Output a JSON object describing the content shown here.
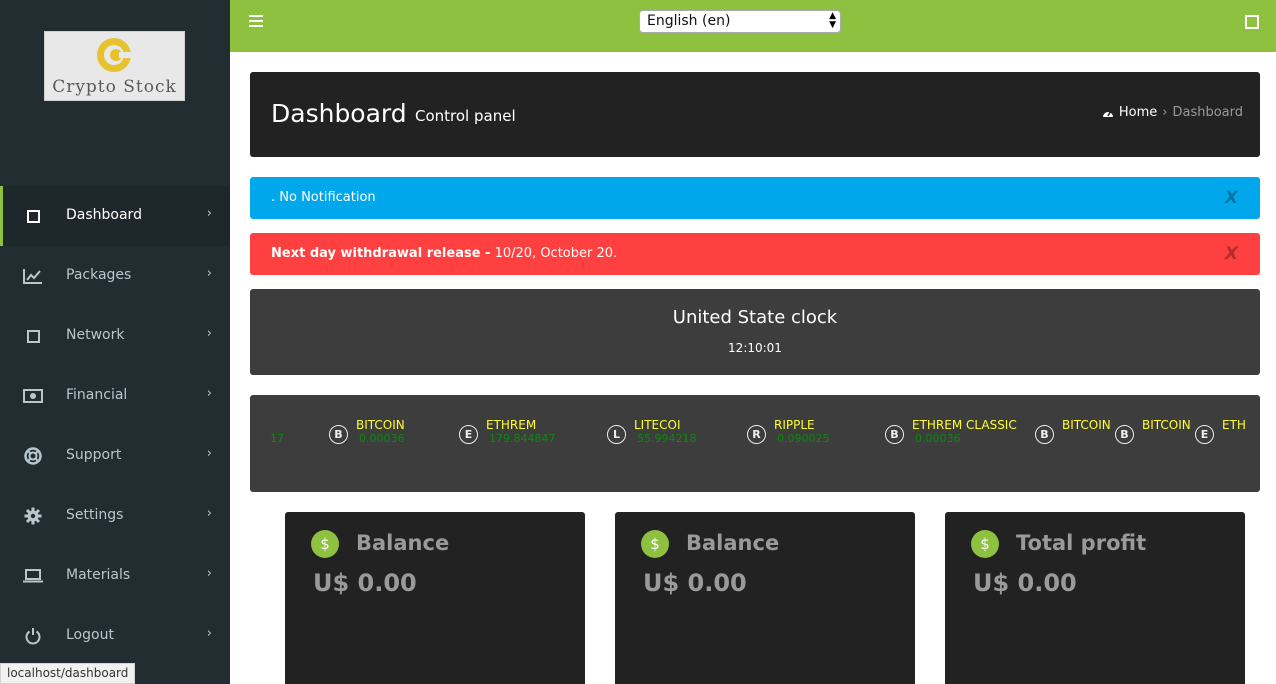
{
  "sidebar": {
    "logo_text": "Crypto Stock",
    "items": [
      {
        "label": "Dashboard",
        "icon": "square-icon",
        "active": true
      },
      {
        "label": "Packages",
        "icon": "chart-line-icon"
      },
      {
        "label": "Network",
        "icon": "square-icon"
      },
      {
        "label": "Financial",
        "icon": "money-icon"
      },
      {
        "label": "Support",
        "icon": "lifering-icon"
      },
      {
        "label": "Settings",
        "icon": "gear-icon"
      },
      {
        "label": "Materials",
        "icon": "laptop-icon"
      },
      {
        "label": "Logout",
        "icon": "power-icon"
      }
    ]
  },
  "status_bar": {
    "url": "localhost/dashboard"
  },
  "topbar": {
    "language": "English (en)"
  },
  "header": {
    "title": "Dashboard",
    "subtitle": "Control panel",
    "breadcrumb_home": "Home",
    "breadcrumb_current": "Dashboard"
  },
  "alerts": {
    "info": ". No Notification",
    "danger_bold": "Next day withdrawal release -",
    "danger_rest": " 10/20, October 20.",
    "close": "X"
  },
  "clock": {
    "title": "United State clock",
    "time": "12:10:01"
  },
  "ticker": {
    "lead": "17",
    "coins": [
      {
        "name": "BITCOIN",
        "price": "0.00036",
        "symbol": "B"
      },
      {
        "name": "ETHREM",
        "price": "179.844847",
        "symbol": "E"
      },
      {
        "name": "LITECOI",
        "price": "55.994218",
        "symbol": "L"
      },
      {
        "name": "RIPPLE",
        "price": "0.090025",
        "symbol": "R"
      },
      {
        "name": "ETHREM CLASSIC",
        "price": "0.00036",
        "symbol": "B"
      },
      {
        "name": "BITCOIN",
        "price": "",
        "symbol": "B"
      },
      {
        "name": "BITCOIN",
        "price": "",
        "symbol": "B"
      },
      {
        "name": "ETH",
        "price": "",
        "symbol": "E"
      }
    ]
  },
  "cards": [
    {
      "title": "Balance",
      "value": "U$ 0.00"
    },
    {
      "title": "Balance",
      "value": "U$ 0.00"
    },
    {
      "title": "Total profit",
      "value": "U$ 0.00"
    }
  ],
  "colors": {
    "sidebar_bg": "#222d32",
    "accent_green": "#8dc13f",
    "info_blue": "#00a7eb",
    "danger_red": "#ff4040",
    "ticker_yellow": "#ffff2e",
    "ticker_green": "#0c8a0c"
  }
}
